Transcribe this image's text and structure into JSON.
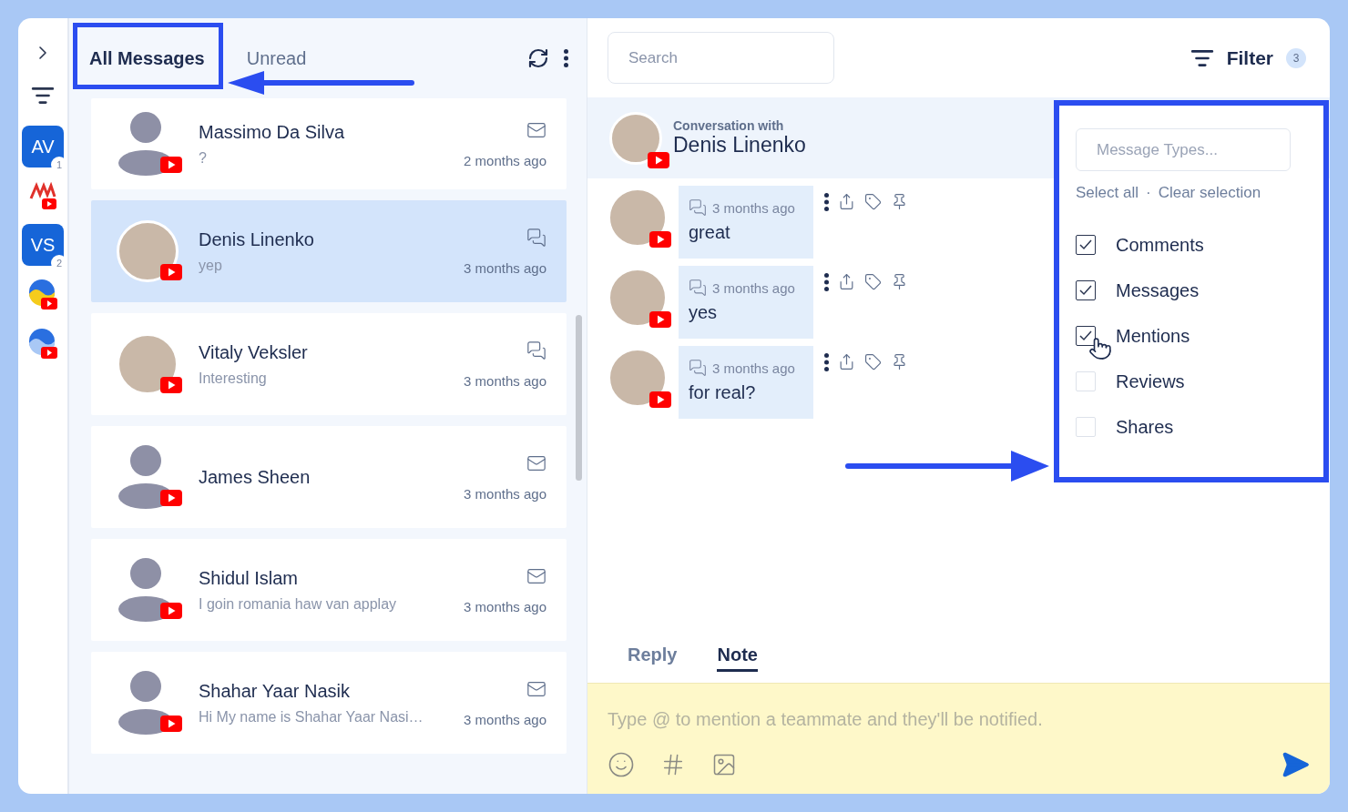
{
  "rail": {
    "accounts": [
      {
        "kind": "initials",
        "initials": "AV",
        "count": "1"
      },
      {
        "kind": "brand"
      },
      {
        "kind": "initials",
        "initials": "VS",
        "count": "2"
      },
      {
        "kind": "globe"
      },
      {
        "kind": "globe"
      }
    ]
  },
  "list_tabs": [
    {
      "label": "All Messages",
      "selected": true
    },
    {
      "label": "Unread",
      "selected": false
    }
  ],
  "conversations": [
    {
      "name": "Massimo Da Silva",
      "preview": "?",
      "time": "2 months ago",
      "kind": "mail",
      "has_photo": false,
      "selected": false
    },
    {
      "name": "Denis Linenko",
      "preview": "yep",
      "time": "3 months ago",
      "kind": "comment",
      "has_photo": true,
      "selected": true
    },
    {
      "name": "Vitaly Veksler",
      "preview": "Interesting",
      "time": "3 months ago",
      "kind": "comment",
      "has_photo": true,
      "selected": false
    },
    {
      "name": "James Sheen",
      "time": "3 months ago",
      "kind": "mail",
      "has_photo": false,
      "selected": false
    },
    {
      "name": "Shidul Islam",
      "preview": "I goin romania haw van applay",
      "time": "3 months ago",
      "kind": "mail",
      "has_photo": false,
      "selected": false
    },
    {
      "name": "Shahar Yaar Nasik",
      "preview": "Hi My name is Shahar Yaar Nasi…",
      "time": "3 months ago",
      "kind": "mail",
      "has_photo": false,
      "selected": false
    }
  ],
  "search": {
    "placeholder": "Search"
  },
  "filter": {
    "label": "Filter",
    "count": "3"
  },
  "conversation": {
    "caption": "Conversation with",
    "name": "Denis Linenko"
  },
  "messages": [
    {
      "time": "3 months ago",
      "text": "great"
    },
    {
      "time": "3 months ago",
      "text": "yes"
    },
    {
      "time": "3 months ago",
      "text": "for real?"
    }
  ],
  "filter_menu": {
    "placeholder": "Message Types...",
    "select_all": "Select all",
    "separator": "·",
    "clear": "Clear selection",
    "options": [
      {
        "label": "Comments",
        "checked": true
      },
      {
        "label": "Messages",
        "checked": true
      },
      {
        "label": "Mentions",
        "checked": true
      },
      {
        "label": "Reviews",
        "checked": false
      },
      {
        "label": "Shares",
        "checked": false
      }
    ]
  },
  "composer_tabs": [
    {
      "label": "Reply",
      "selected": false
    },
    {
      "label": "Note",
      "selected": true
    }
  ],
  "composer": {
    "placeholder": "Type @ to mention a teammate and they'll be notified."
  }
}
